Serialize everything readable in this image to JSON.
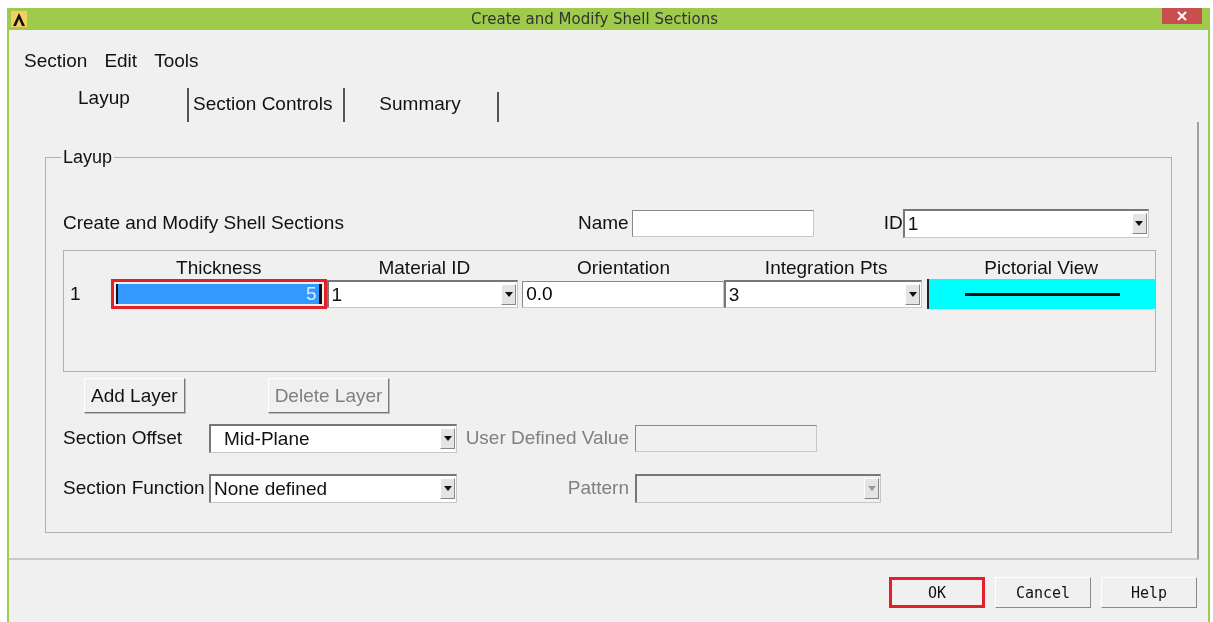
{
  "window": {
    "title": "Create and Modify Shell Sections"
  },
  "menu": [
    {
      "label": "Section"
    },
    {
      "label": "Edit"
    },
    {
      "label": "Tools"
    }
  ],
  "tabs": [
    {
      "label": "Layup",
      "selected": true
    },
    {
      "label": "Section Controls",
      "selected": false
    },
    {
      "label": "Summary",
      "selected": false
    }
  ],
  "layup_group": {
    "label": "Layup",
    "heading": "Create and Modify Shell Sections",
    "name_label": "Name",
    "id_label": "ID",
    "id_value": "1"
  },
  "table": {
    "columns": [
      "Thickness",
      "Material ID",
      "Orientation",
      "Integration Pts",
      "Pictorial View"
    ],
    "rows": [
      {
        "number": "1",
        "thickness": "5",
        "thickness_selected": true,
        "thickness_annotated": true,
        "material_id": "1",
        "orientation": "0.0",
        "integration_pts": "3"
      }
    ]
  },
  "layer_buttons": [
    {
      "label": "Add Layer",
      "disabled": false
    },
    {
      "label": "Delete Layer",
      "disabled": true
    }
  ],
  "section_offset": {
    "label": "Section Offset",
    "value": "Mid-Plane",
    "extra_label": "User Defined Value",
    "extra_disabled": true
  },
  "section_function": {
    "label": "Section Function",
    "value": "None defined",
    "extra_label": "Pattern",
    "extra_disabled": true
  },
  "footer_buttons": [
    {
      "label": "OK",
      "annotated": true
    },
    {
      "label": "Cancel",
      "annotated": false
    },
    {
      "label": "Help",
      "annotated": false
    }
  ]
}
